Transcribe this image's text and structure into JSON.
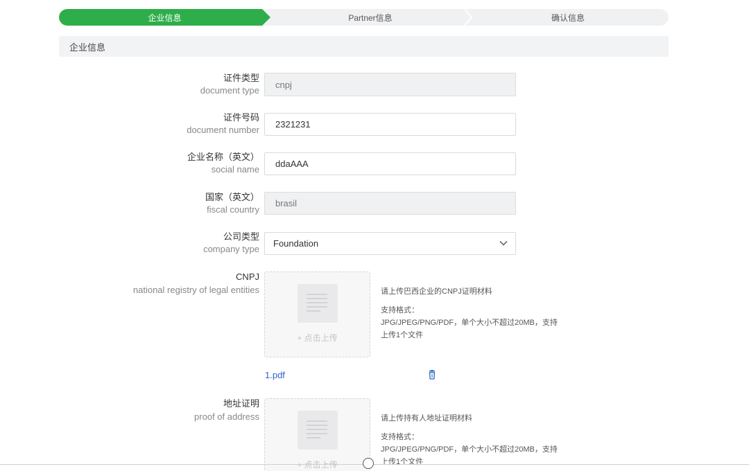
{
  "stepper": {
    "steps": [
      {
        "label": "企业信息",
        "active": true
      },
      {
        "label": "Partner信息",
        "active": false
      },
      {
        "label": "确认信息",
        "active": false
      }
    ]
  },
  "section": {
    "title": "企业信息"
  },
  "form": {
    "document_type": {
      "label_zh": "证件类型",
      "label_en": "document type",
      "value": "cnpj"
    },
    "document_number": {
      "label_zh": "证件号码",
      "label_en": "document number",
      "value": "2321231"
    },
    "social_name": {
      "label_zh": "企业名称（英文）",
      "label_en": "social name",
      "value": "ddaAAA"
    },
    "fiscal_country": {
      "label_zh": "国家（英文）",
      "label_en": "fiscal country",
      "value": "brasil"
    },
    "company_type": {
      "label_zh": "公司类型",
      "label_en": "company type",
      "value": "Foundation"
    },
    "cnpj": {
      "label_zh": "CNPJ",
      "label_en": "national registry of legal entities",
      "upload_label": "+ 点击上传",
      "hint_title": "请上传巴西企业的CNPJ证明材料",
      "hint_formats_label": "支持格式：",
      "hint_formats_line1": "JPG/JPEG/PNG/PDF，单个大小不超过20MB，支持",
      "hint_formats_line2": "上传1个文件",
      "file_name": "1.pdf"
    },
    "proof_of_address": {
      "label_zh": "地址证明",
      "label_en": "proof of address",
      "upload_label": "+ 点击上传",
      "hint_title": "请上传持有人地址证明材料",
      "hint_formats_label": "支持格式：",
      "hint_formats_line1": "JPG/JPEG/PNG/PDF，单个大小不超过20MB，支持",
      "hint_formats_line2": "上传1个文件"
    }
  },
  "colors": {
    "accent": "#2eae4a",
    "link": "#2b64c8",
    "disabled_bg": "#f0f1f3"
  },
  "icons": {
    "select": "chevron-down-icon",
    "delete": "trash-icon",
    "upload": "document-icon"
  }
}
